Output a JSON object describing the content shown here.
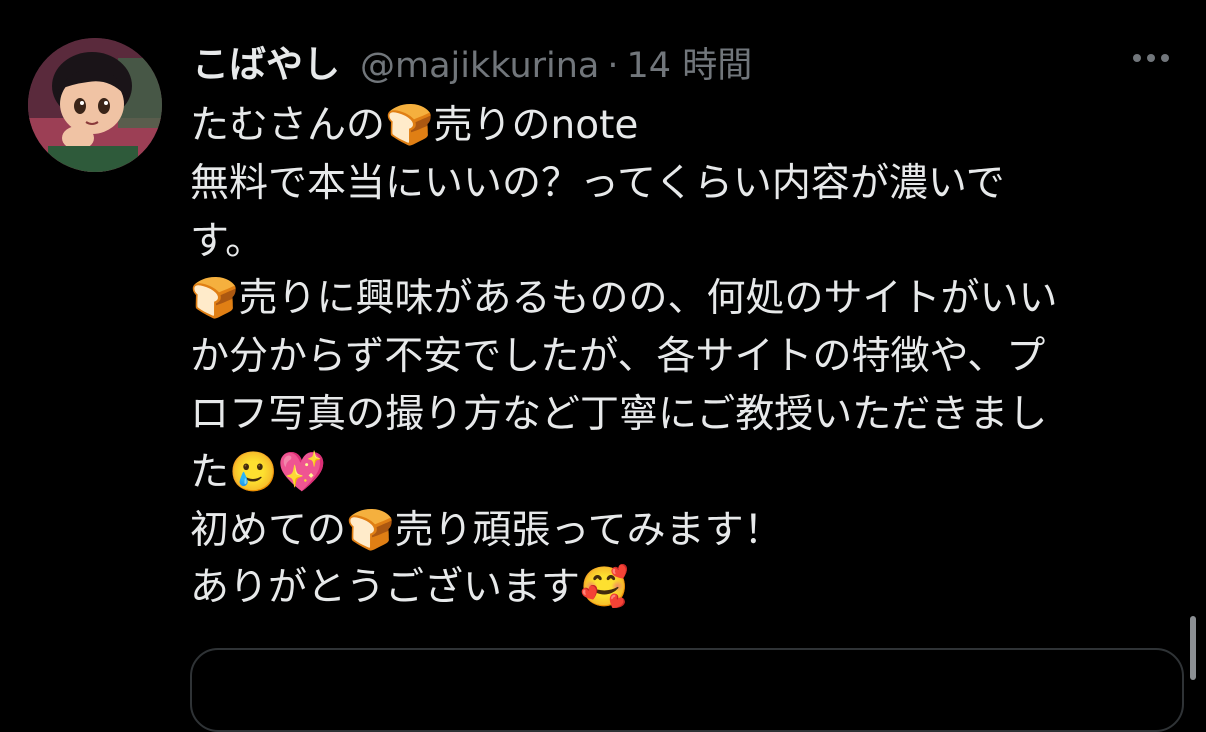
{
  "tweet": {
    "author": {
      "display_name": "こばやし",
      "handle": "@majikkurina",
      "separator": "·",
      "time": "14 時間"
    },
    "body_lines": [
      "たむさんの🍞売りのnote",
      "無料で本当にいいの？ってくらい内容が濃いで",
      "す。",
      "🍞売りに興味があるものの、何処のサイトがいい",
      "か分からず不安でしたが、各サイトの特徴や、プ",
      "ロフ写真の撮り方など丁寧にご教授いただきまし",
      "た🥲💖",
      "初めての🍞売り頑張ってみます！",
      "ありがとうございます🥰"
    ],
    "more_icon": "more-horizontal-icon"
  },
  "colors": {
    "background": "#000000",
    "primary_text": "#e7e9ea",
    "secondary_text": "#71767b",
    "border": "#2f3336"
  }
}
